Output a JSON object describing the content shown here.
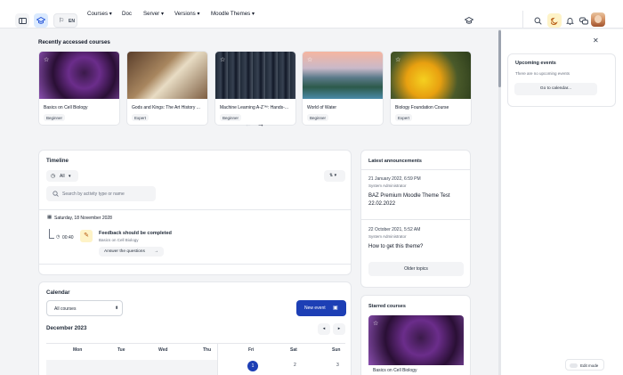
{
  "header": {
    "lang": "EN",
    "nav": [
      "Courses",
      "Doc",
      "Server",
      "Versions",
      "Moodle Themes"
    ]
  },
  "recent": {
    "title": "Recently accessed courses",
    "courses": [
      {
        "name": "Basics on Cell Biology",
        "badge": "Beginner"
      },
      {
        "name": "Gods and Kings: The Art History ...",
        "badge": "Expert"
      },
      {
        "name": "Machine Learning A-Z™: Hands-...",
        "badge": "Beginner"
      },
      {
        "name": "World of Water",
        "badge": "Beginner"
      },
      {
        "name": "Biology Foundation Course",
        "badge": "Expert"
      }
    ]
  },
  "timeline": {
    "title": "Timeline",
    "filter": "All",
    "search_placeholder": "Search by activity type or name",
    "date": "Saturday, 18 November 2028",
    "time": "00:40",
    "event_title": "Feedback should be completed",
    "event_course": "Basics on Cell Biology",
    "action": "Answer the questions"
  },
  "calendar": {
    "title": "Calendar",
    "select": "All courses",
    "new_event": "New event",
    "month": "December 2023",
    "days": [
      "Mon",
      "Tue",
      "Wed",
      "Thu",
      "Fri",
      "Sat",
      "Sun"
    ],
    "dates": [
      "1",
      "2",
      "3"
    ]
  },
  "announcements": {
    "title": "Latest announcements",
    "items": [
      {
        "date": "21 January 2022, 6:59 PM",
        "author": "System Administrator",
        "title": "BAZ Premium Moodle Theme Test 22.02.2022"
      },
      {
        "date": "22 October 2021, 5:52 AM",
        "author": "System Administrator",
        "title": "How to get this theme?"
      }
    ],
    "older": "Older topics"
  },
  "starred": {
    "title": "Starred courses",
    "course": "Basics on Cell Biology"
  },
  "upcoming": {
    "title": "Upcoming events",
    "empty": "There are no upcoming events",
    "button": "Go to calendar..."
  },
  "edit_mode": "Edit mode"
}
